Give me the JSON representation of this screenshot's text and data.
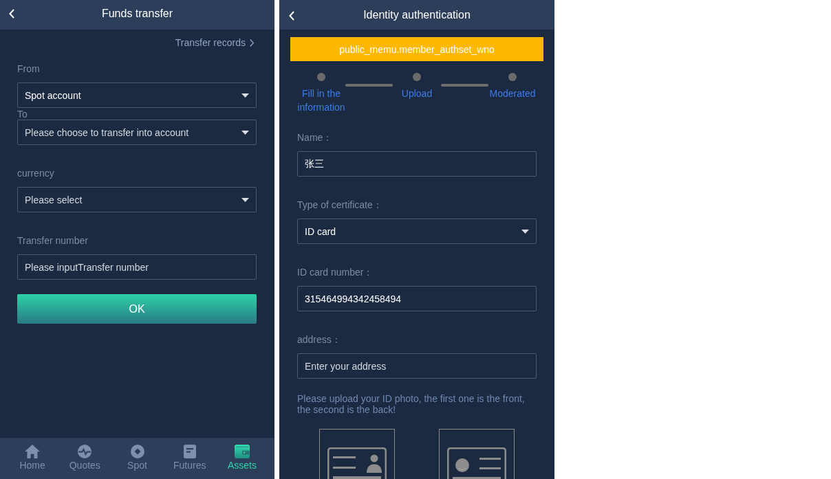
{
  "funds_transfer": {
    "header": {
      "title": "Funds transfer"
    },
    "records_link": "Transfer records",
    "fields": [
      {
        "kind": "select",
        "label": "From",
        "value": "Spot account"
      },
      {
        "kind": "select",
        "label": "To",
        "placeholder": "Please choose to transfer into account"
      },
      {
        "kind": "select",
        "label": "currency",
        "placeholder": "Please select"
      },
      {
        "kind": "input",
        "label": "Transfer number",
        "placeholder": "Please inputTransfer number"
      }
    ],
    "button": "OK",
    "nav": [
      {
        "label": "Home",
        "selected": false
      },
      {
        "label": "Quotes",
        "selected": false
      },
      {
        "label": "Spot",
        "selected": false
      },
      {
        "label": "Futures",
        "selected": false
      },
      {
        "label": "Assets",
        "selected": true
      }
    ]
  },
  "identity_authentication": {
    "header": {
      "title": "Identity authentication"
    },
    "banner": "public_memu.member_authset_wno",
    "steps": [
      {
        "label": "Fill in the information"
      },
      {
        "label": "Upload"
      },
      {
        "label": "Moderated"
      }
    ],
    "fields": [
      {
        "kind": "input",
        "label": "Name：",
        "value": "张三"
      },
      {
        "kind": "select",
        "label": "Type of certificate：",
        "value": "ID card"
      },
      {
        "kind": "input",
        "label": "ID card number：",
        "value": "315464994342458494"
      },
      {
        "kind": "input",
        "label": "address：",
        "placeholder": "Enter your address"
      }
    ],
    "upload_note": "Please upload your ID photo, the first one is the front, the second is the back!",
    "uploads": [
      {
        "kind": "front"
      },
      {
        "kind": "back"
      }
    ]
  }
}
